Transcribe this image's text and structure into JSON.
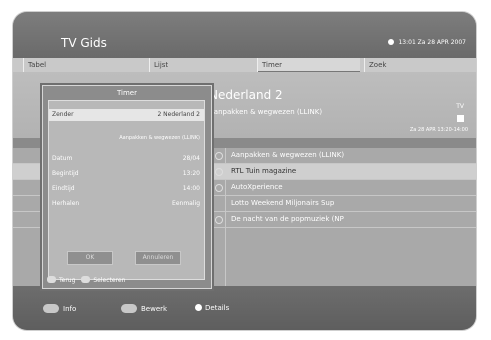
{
  "header": {
    "title": "TV Gids",
    "clock": "13:01 Za 28 APR 2007"
  },
  "tabs": [
    {
      "label": "Tabel"
    },
    {
      "label": "Lijst"
    },
    {
      "label": "Timer",
      "active": true
    },
    {
      "label": "Zoek"
    }
  ],
  "info": {
    "channel": "Nederland 2",
    "programme": "Aanpakken & wegwezen (LLINK)",
    "badge": "TV",
    "datetime": "Za 28 APR 13:20-14:00"
  },
  "list": {
    "items": [
      "Aanpakken & wegwezen (LLINK)",
      "RTL Tuin magazine",
      "AutoXperience",
      "Lotto Weekend Miljonairs Sup",
      "De nacht van de popmuziek (NP"
    ]
  },
  "dialog": {
    "title": "Timer",
    "zender_label": "Zender",
    "zender_value": "2 Nederland 2",
    "programme": "Aanpakken & wegwezen (LLINK)",
    "rows": [
      {
        "label": "Datum",
        "value": "28/04"
      },
      {
        "label": "Begintijd",
        "value": "13:20"
      },
      {
        "label": "Eindtijd",
        "value": "14:00"
      },
      {
        "label": "Herhalen",
        "value": "Eenmalig"
      }
    ],
    "ok": "OK",
    "cancel": "Annuleren",
    "footer": {
      "back_key": "Terug",
      "select_key": "Selecteren"
    }
  },
  "footer": {
    "info_label": "Info",
    "edit_label": "Bewerk",
    "details_label": "Details"
  }
}
